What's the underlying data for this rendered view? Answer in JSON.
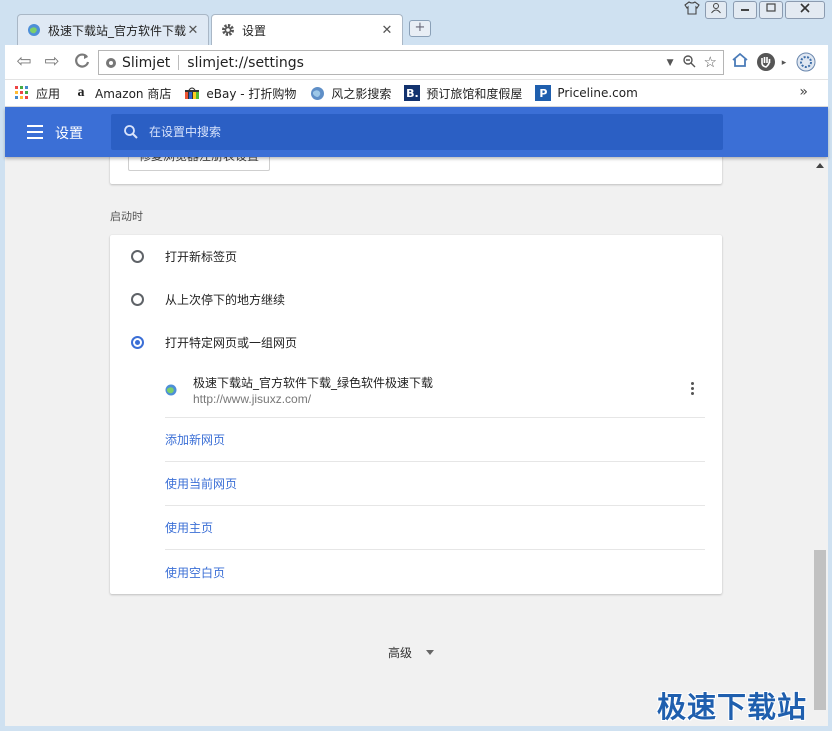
{
  "tabs": [
    {
      "label": "极速下载站_官方软件下载",
      "active": false,
      "icon": "globe-icon"
    },
    {
      "label": "设置",
      "active": true,
      "icon": "gear-icon"
    }
  ],
  "window_controls": [
    "shirt-icon",
    "user-icon",
    "minimize-icon",
    "maximize-icon",
    "close-icon"
  ],
  "toolbar": {
    "site_chip": "Slimjet",
    "url": "slimjet://settings"
  },
  "bookmarks": [
    {
      "label": "应用",
      "icon": "apps-grid-icon"
    },
    {
      "label": "Amazon 商店",
      "icon": "amazon-icon"
    },
    {
      "label": "eBay - 打折购物",
      "icon": "ebay-bag-icon"
    },
    {
      "label": "风之影搜索",
      "icon": "globe-icon"
    },
    {
      "label": "预订旅馆和度假屋",
      "icon": "booking-icon"
    },
    {
      "label": "Priceline.com",
      "icon": "priceline-icon"
    }
  ],
  "settings": {
    "title": "设置",
    "search_placeholder": "在设置中搜索",
    "repair_button": "修复浏览器注册表设置",
    "startup_section": "启动时",
    "startup_options": [
      {
        "label": "打开新标签页",
        "checked": false
      },
      {
        "label": "从上次停下的地方继续",
        "checked": false
      },
      {
        "label": "打开特定网页或一组网页",
        "checked": true
      }
    ],
    "startup_page": {
      "title": "极速下载站_官方软件下载_绿色软件极速下载",
      "url": "http://www.jisuxz.com/"
    },
    "actions": [
      "添加新网页",
      "使用当前网页",
      "使用主页",
      "使用空白页"
    ],
    "advanced_label": "高级"
  },
  "colors": {
    "accent": "#3b6fd6",
    "header_bg": "#3b6fd6",
    "search_bg": "#2b5fc4",
    "watermark": "#1f5fae"
  },
  "watermark": "极速下载站"
}
